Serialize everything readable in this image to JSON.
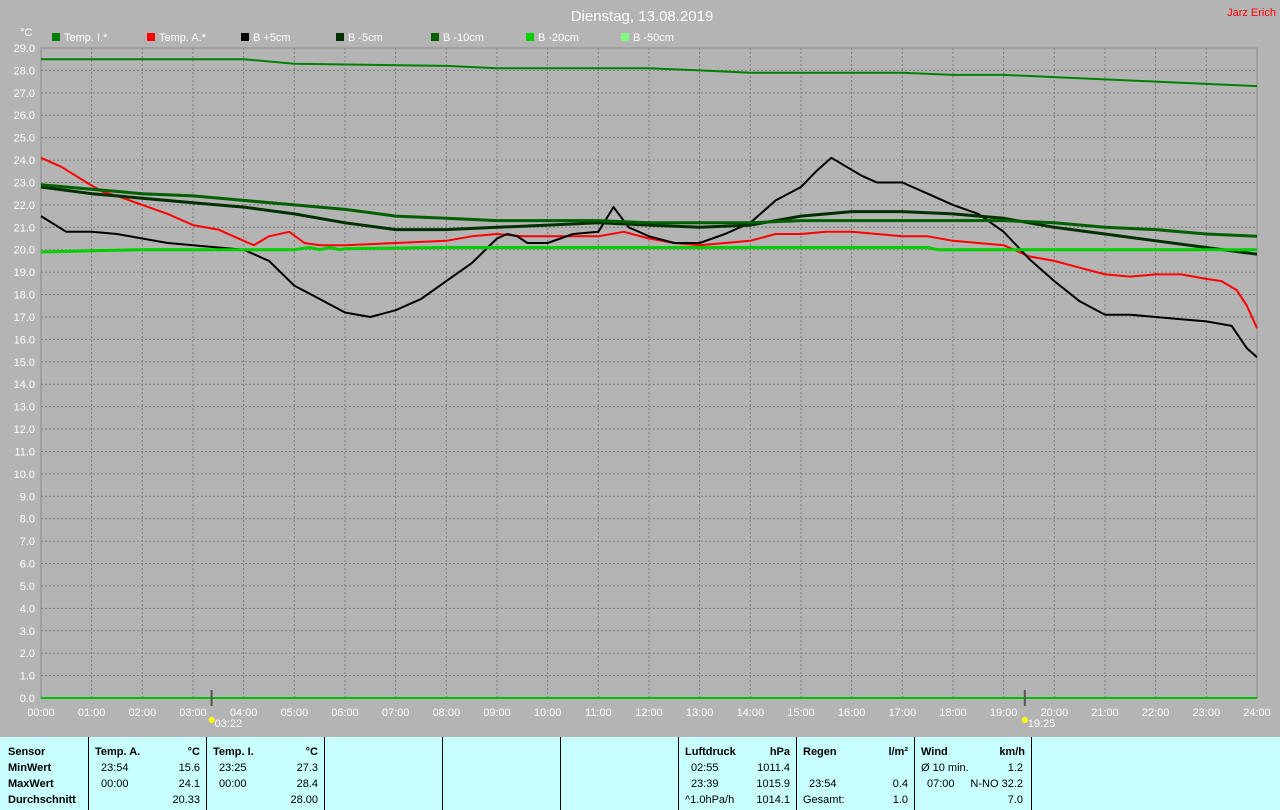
{
  "title": "Dienstag, 13.08.2019",
  "author": "Jarz Erich",
  "colors": {
    "background": "#b4b4b4",
    "plot": "#b4b4b4",
    "grid": "#777777",
    "axis_text": "#ffffff",
    "title": "#ffffff",
    "author": "#ff0000",
    "stats_bg": "#c8ffff"
  },
  "chart_data": {
    "type": "line",
    "ylabel": "°C",
    "ylim": [
      0,
      29
    ],
    "yticks": [
      "0.0",
      "1.0",
      "2.0",
      "3.0",
      "4.0",
      "5.0",
      "6.0",
      "7.0",
      "8.0",
      "9.0",
      "10.0",
      "11.0",
      "12.0",
      "13.0",
      "14.0",
      "15.0",
      "16.0",
      "17.0",
      "18.0",
      "19.0",
      "20.0",
      "21.0",
      "22.0",
      "23.0",
      "24.0",
      "25.0",
      "26.0",
      "27.0",
      "28.0",
      "29.0"
    ],
    "xlim": [
      0,
      24
    ],
    "xticks": [
      "00:00",
      "01:00",
      "02:00",
      "03:00",
      "04:00",
      "05:00",
      "06:00",
      "07:00",
      "08:00",
      "09:00",
      "10:00",
      "11:00",
      "12:00",
      "13:00",
      "14:00",
      "15:00",
      "16:00",
      "17:00",
      "18:00",
      "19:00",
      "20:00",
      "21:00",
      "22:00",
      "23:00",
      "24:00"
    ],
    "grid": true,
    "legend_position": "top",
    "events": [
      {
        "label": "03:22",
        "hour": 3.367,
        "icon": "sunrise-icon"
      },
      {
        "label": "19:25",
        "hour": 19.417,
        "icon": "sunset-icon"
      }
    ],
    "series": [
      {
        "name": "Temp. I.*",
        "color": "#008000",
        "width": 2,
        "x": [
          0,
          4,
          5,
          8,
          9,
          12,
          13,
          14,
          15,
          17,
          18,
          19,
          20,
          22,
          23,
          24
        ],
        "y": [
          28.5,
          28.5,
          28.3,
          28.2,
          28.1,
          28.1,
          28.0,
          27.9,
          27.9,
          27.9,
          27.8,
          27.8,
          27.7,
          27.5,
          27.4,
          27.3
        ]
      },
      {
        "name": "Temp. A.*",
        "color": "#ff0000",
        "width": 2,
        "x": [
          0,
          0.4,
          0.9,
          1.2,
          1.5,
          2,
          2.5,
          3,
          3.5,
          4,
          4.2,
          4.5,
          4.9,
          5.2,
          5.5,
          6,
          7,
          8,
          8.5,
          9,
          9.5,
          10,
          10.5,
          11,
          11.5,
          12,
          12.5,
          13,
          13.5,
          14,
          14.5,
          15,
          15.5,
          16,
          16.5,
          17,
          17.5,
          18,
          18.5,
          19,
          19.5,
          20,
          20.5,
          21,
          21.5,
          22,
          22.5,
          23,
          23.3,
          23.6,
          23.8,
          24
        ],
        "y": [
          24.1,
          23.7,
          23.0,
          22.6,
          22.4,
          22.0,
          21.6,
          21.1,
          20.9,
          20.4,
          20.2,
          20.6,
          20.8,
          20.3,
          20.2,
          20.2,
          20.3,
          20.4,
          20.6,
          20.7,
          20.6,
          20.6,
          20.6,
          20.6,
          20.8,
          20.5,
          20.3,
          20.2,
          20.3,
          20.4,
          20.7,
          20.7,
          20.8,
          20.8,
          20.7,
          20.6,
          20.6,
          20.4,
          20.3,
          20.2,
          19.7,
          19.5,
          19.2,
          18.9,
          18.8,
          18.9,
          18.9,
          18.7,
          18.6,
          18.2,
          17.5,
          16.5
        ]
      },
      {
        "name": "B +5cm",
        "color": "#000000",
        "width": 2,
        "x": [
          0,
          0.5,
          1,
          1.5,
          2,
          2.5,
          3,
          3.5,
          4,
          4.5,
          5,
          5.5,
          6,
          6.5,
          7,
          7.5,
          8,
          8.5,
          9,
          9.2,
          9.4,
          9.6,
          10,
          10.5,
          11,
          11.3,
          11.6,
          12,
          12.5,
          13,
          13.5,
          14,
          14.5,
          15,
          15.3,
          15.6,
          15.9,
          16.2,
          16.5,
          17,
          17.5,
          18,
          18.5,
          19,
          19.5,
          20,
          20.5,
          21,
          21.5,
          22,
          22.5,
          23,
          23.5,
          23.8,
          24
        ],
        "y": [
          21.5,
          20.8,
          20.8,
          20.7,
          20.5,
          20.3,
          20.2,
          20.1,
          20.0,
          19.5,
          18.4,
          17.8,
          17.2,
          17.0,
          17.3,
          17.8,
          18.6,
          19.4,
          20.5,
          20.7,
          20.6,
          20.3,
          20.3,
          20.7,
          20.8,
          21.9,
          21.0,
          20.6,
          20.3,
          20.3,
          20.7,
          21.2,
          22.2,
          22.8,
          23.5,
          24.1,
          23.7,
          23.3,
          23.0,
          23.0,
          22.5,
          22.0,
          21.6,
          20.8,
          19.6,
          18.6,
          17.7,
          17.1,
          17.1,
          17.0,
          16.9,
          16.8,
          16.6,
          15.6,
          15.2
        ]
      },
      {
        "name": "B -5cm",
        "color": "#003000",
        "width": 3,
        "x": [
          0,
          1,
          2,
          3,
          4,
          5,
          6,
          7,
          8,
          9,
          10,
          11,
          12,
          13,
          14,
          14.5,
          15,
          15.5,
          16,
          17,
          18,
          19,
          19.5,
          20,
          21,
          22,
          23,
          24
        ],
        "y": [
          22.8,
          22.5,
          22.3,
          22.1,
          21.9,
          21.6,
          21.2,
          20.9,
          20.9,
          21.0,
          21.1,
          21.2,
          21.1,
          21.0,
          21.1,
          21.3,
          21.5,
          21.6,
          21.7,
          21.7,
          21.6,
          21.4,
          21.2,
          21.0,
          20.7,
          20.4,
          20.1,
          19.8
        ]
      },
      {
        "name": "B -10cm",
        "color": "#006000",
        "width": 3,
        "x": [
          0,
          1,
          2,
          3,
          4,
          5,
          6,
          7,
          8,
          9,
          10,
          11,
          12,
          13,
          14,
          15,
          16,
          17,
          18,
          19,
          20,
          21,
          22,
          23,
          24
        ],
        "y": [
          22.9,
          22.7,
          22.5,
          22.4,
          22.2,
          22.0,
          21.8,
          21.5,
          21.4,
          21.3,
          21.3,
          21.3,
          21.2,
          21.2,
          21.2,
          21.3,
          21.3,
          21.3,
          21.3,
          21.3,
          21.2,
          21.0,
          20.9,
          20.7,
          20.6
        ]
      },
      {
        "name": "B -20cm",
        "color": "#00d000",
        "width": 3,
        "x": [
          0,
          1,
          2,
          4,
          5,
          5.3,
          5.5,
          5.7,
          5.9,
          6,
          8,
          10,
          12,
          14,
          16,
          17,
          17.5,
          17.7,
          18,
          20,
          22,
          24
        ],
        "y": [
          19.9,
          19.95,
          20.0,
          20.0,
          20.0,
          20.1,
          20.0,
          20.1,
          20.0,
          20.05,
          20.1,
          20.1,
          20.1,
          20.1,
          20.1,
          20.1,
          20.1,
          20.0,
          20.0,
          20.0,
          20.0,
          20.0
        ]
      },
      {
        "name": "B -50cm",
        "color": "#80ff80",
        "width": 2,
        "x": [],
        "y": []
      }
    ]
  },
  "stats": {
    "sensor_header": "Sensor",
    "min_label": "MinWert",
    "max_label": "MaxWert",
    "avg_label": "Durchschnitt",
    "temp_a": {
      "header": "Temp. A.",
      "unit": "°C",
      "min_time": "23:54",
      "min_val": "15.6",
      "max_time": "00:00",
      "max_val": "24.1",
      "avg": "20.33"
    },
    "temp_i": {
      "header": "Temp. I.",
      "unit": "°C",
      "min_time": "23:25",
      "min_val": "27.3",
      "max_time": "00:00",
      "max_val": "28.4",
      "avg": "28.00"
    },
    "pressure": {
      "header": "Luftdruck",
      "unit": "hPa",
      "min_time": "02:55",
      "min_val": "1011.4",
      "max_time": "23:39",
      "max_val": "1015.9",
      "row3_label": "^1.0hPa/h",
      "row3_val": "1014.1"
    },
    "rain": {
      "header": "Regen",
      "unit": "l/m²",
      "row2_time": "23:54",
      "row2_val": "0.4",
      "total_label": "Gesamt:",
      "total_val": "1.0"
    },
    "wind": {
      "header": "Wind",
      "unit": "km/h",
      "avg_label": "Ø 10 min.",
      "avg_val": "1.2",
      "max_time": "07:00",
      "max_val": "N-NO 32.2",
      "row3_val": "7.0"
    }
  }
}
